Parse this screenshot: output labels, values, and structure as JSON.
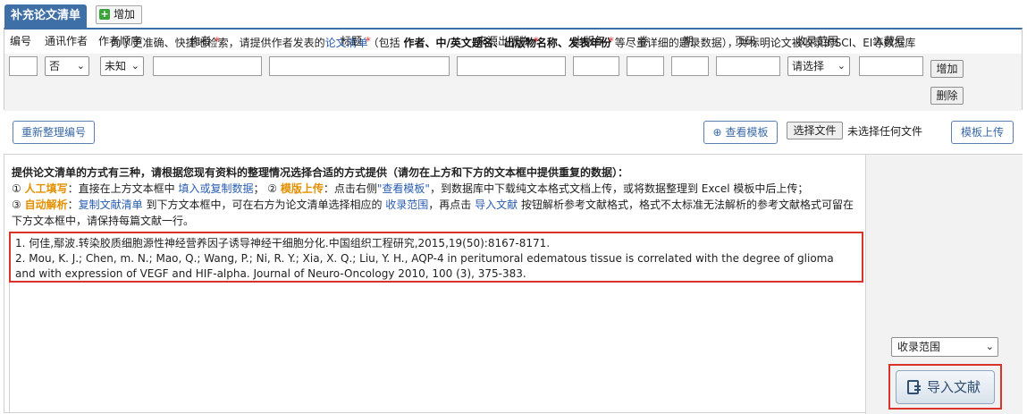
{
  "tabs": {
    "active": "补充论文清单",
    "add": "增加"
  },
  "notice": {
    "prefix": "为了更准确、快捷地检索，请提供作者发表的",
    "link": "论文清单",
    "mid1": "（包括 ",
    "bold": "作者、中/英文题名、出版物名称、发表年份",
    "suffix": " 等尽量详细的题录数据），并标明论文被收录的SCI、EI等数据库"
  },
  "table": {
    "headers": {
      "number": "编号",
      "corresponding": "通讯作者",
      "order": "作者顺序",
      "author": "作者",
      "title": "标题",
      "source": "来源出版物",
      "year": "出版年",
      "volume": "卷",
      "issue": "期",
      "pages": "页码",
      "indexed": "收录范围",
      "accession": "入藏号",
      "add": "增加"
    },
    "required_mark": "*",
    "row": {
      "corresponding": "否",
      "order": "未知",
      "indexed": "请选择",
      "delete": "删除"
    }
  },
  "actions": {
    "renumber": "重新整理编号",
    "view_template": "查看模板",
    "choose_file": "选择文件",
    "no_file": "未选择任何文件",
    "template_upload": "模板上传"
  },
  "instructions": {
    "heading": "提供论文清单的方式有三种，请根据您现有资料的整理情况选择合适的方式提供（请勿在上方和下方的文本框中提供重复的数据）：",
    "l1_num": "①",
    "l1_label": "人工填写",
    "l1_text_a": "：直接在上方文本框中 ",
    "l1_link": "填入或复制数据",
    "l1_text_b": "； ",
    "l2_num": "②",
    "l2_label": "模版上传",
    "l2_text_a": "：点击右侧",
    "l2_link": "\"查看模板\"",
    "l2_text_b": "，到数据库中下载纯文本格式文档上传，或将数据整理到 Excel 模板中后上传；",
    "l3_num": "③",
    "l3_label": "自动解析",
    "l3_text_a": "：",
    "l3_link1": "复制文献清单",
    "l3_text_b": " 到下方文本框中，可在右方为论文清单选择相应的 ",
    "l3_link2": "收录范围",
    "l3_text_c": "，再点击 ",
    "l3_link3": "导入文献",
    "l3_text_d": " 按钮解析参考文献格式，格式不太标准无法解析的参考文献格式可留在",
    "l4": "下方文本框中，请保持每篇文献一行。"
  },
  "references": [
    "1. 何佳,鄢波.转染胶质细胞源性神经营养因子诱导神经干细胞分化.中国组织工程研究,2015,19(50):8167-8171.",
    "2. Mou, K. J.; Chen, m. N.; Mao, Q.; Wang, P.; Ni, R. Y.; Xia, X. Q.; Liu, Y. H., AQP-4 in peritumoral edematous tissue is correlated with the degree of glioma and with expression of VEGF and HIF-alpha. Journal of Neuro-Oncology 2010, 100 (3), 375-383."
  ],
  "right_panel": {
    "scope_select": "收录范围",
    "import_button": "导入文献"
  }
}
